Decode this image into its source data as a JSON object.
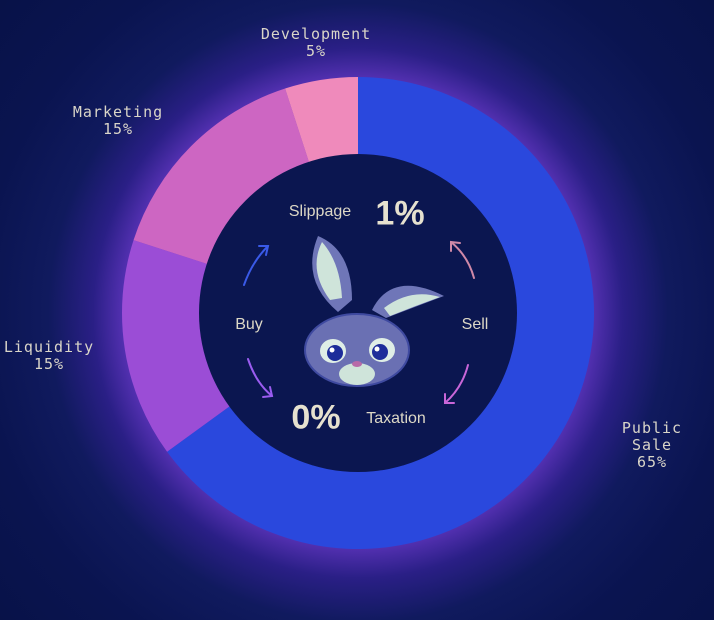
{
  "chart_data": {
    "type": "pie",
    "donut": true,
    "categories": [
      "Public Sale",
      "Liquidity",
      "Marketing",
      "Development"
    ],
    "values": [
      65,
      15,
      15,
      5
    ],
    "value_labels": [
      "65%",
      "15%",
      "15%",
      "5%"
    ],
    "colors": [
      "#2a48dd",
      "#9b4dd6",
      "#cd66c2",
      "#ef8abb"
    ],
    "start": "top",
    "direction": "clockwise"
  },
  "center": {
    "slippage_label": "Slippage",
    "slippage_value": "1%",
    "taxation_label": "Taxation",
    "taxation_value": "0%",
    "buy_label": "Buy",
    "sell_label": "Sell"
  },
  "colors": {
    "background": "#0a1450",
    "center": "#0b1650"
  }
}
